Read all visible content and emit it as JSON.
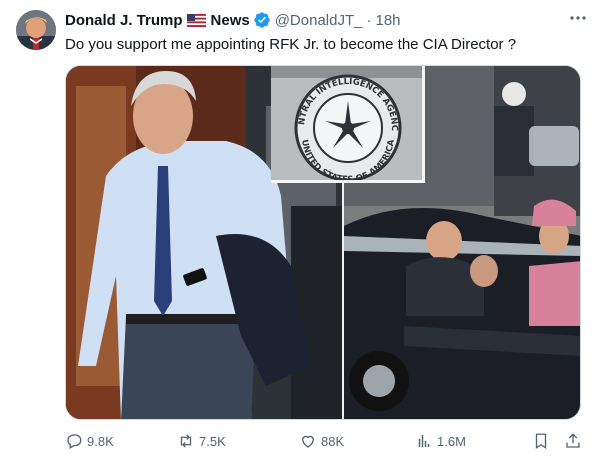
{
  "tweet": {
    "author_name": "Donald J. Trump",
    "author_suffix": "News",
    "handle": "@DonaldJT_",
    "separator": "·",
    "time": "18h",
    "text": "Do you support me appointing RFK Jr. to become the CIA Director ?",
    "seal_text": "CENTRAL INTELLIGENCE AGENCY",
    "seal_bottom": "UNITED STATES OF AMERICA"
  },
  "actions": {
    "replies": "9.8K",
    "reposts": "7.5K",
    "likes": "88K",
    "views": "1.6M"
  },
  "colors": {
    "verified": "#1d9bf0",
    "muted": "#536471"
  },
  "icons": [
    "more-icon",
    "verified-icon",
    "flag-us-icon",
    "reply-icon",
    "repost-icon",
    "like-icon",
    "views-icon",
    "bookmark-icon",
    "share-icon"
  ]
}
